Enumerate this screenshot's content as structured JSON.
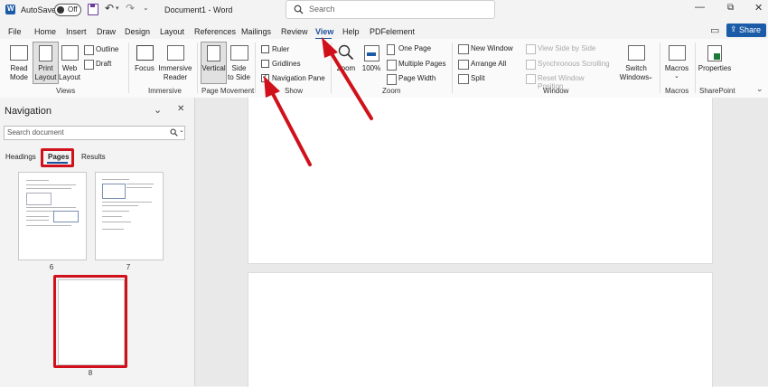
{
  "titlebar": {
    "autosave_label": "AutoSave",
    "autosave_state": "Off",
    "document_title": "Document1 - Word",
    "search_placeholder": "Search"
  },
  "menu": {
    "tabs": [
      "File",
      "Home",
      "Insert",
      "Draw",
      "Design",
      "Layout",
      "References",
      "Mailings",
      "Review",
      "View",
      "Help",
      "PDFelement"
    ],
    "active_tab": "View",
    "share_label": "Share"
  },
  "ribbon": {
    "views": {
      "group_label": "Views",
      "read_mode": [
        "Read",
        "Mode"
      ],
      "print_layout": [
        "Print",
        "Layout"
      ],
      "web_layout": [
        "Web",
        "Layout"
      ],
      "outline": "Outline",
      "draft": "Draft"
    },
    "immersive": {
      "group_label": "Immersive",
      "focus": "Focus",
      "immersive_reader": [
        "Immersive",
        "Reader"
      ]
    },
    "page_movement": {
      "group_label": "Page Movement",
      "vertical": "Vertical",
      "side_to_side": [
        "Side",
        "to Side"
      ]
    },
    "show": {
      "group_label": "Show",
      "ruler": "Ruler",
      "gridlines": "Gridlines",
      "navigation_pane": "Navigation Pane",
      "ruler_checked": false,
      "gridlines_checked": false,
      "navigation_pane_checked": true
    },
    "zoom": {
      "group_label": "Zoom",
      "zoom": "Zoom",
      "hundred": "100%",
      "one_page": "One Page",
      "multiple_pages": "Multiple Pages",
      "page_width": "Page Width"
    },
    "window": {
      "group_label": "Window",
      "new_window": "New Window",
      "arrange_all": "Arrange All",
      "split": "Split",
      "view_side_by_side": "View Side by Side",
      "synchronous_scrolling": "Synchronous Scrolling",
      "reset_window_position": "Reset Window Position",
      "switch_windows": [
        "Switch",
        "Windows"
      ]
    },
    "macros": {
      "group_label": "Macros",
      "macros": "Macros"
    },
    "sharepoint": {
      "group_label": "SharePoint",
      "properties": "Properties"
    }
  },
  "navigation": {
    "title": "Navigation",
    "search_placeholder": "Search document",
    "tabs": [
      "Headings",
      "Pages",
      "Results"
    ],
    "active_tab": "Pages",
    "pages": [
      "6",
      "7",
      "8"
    ]
  },
  "colors": {
    "accent": "#1b4f9c",
    "annotation_red": "#d0101a",
    "share_button": "#1b5ba8"
  }
}
